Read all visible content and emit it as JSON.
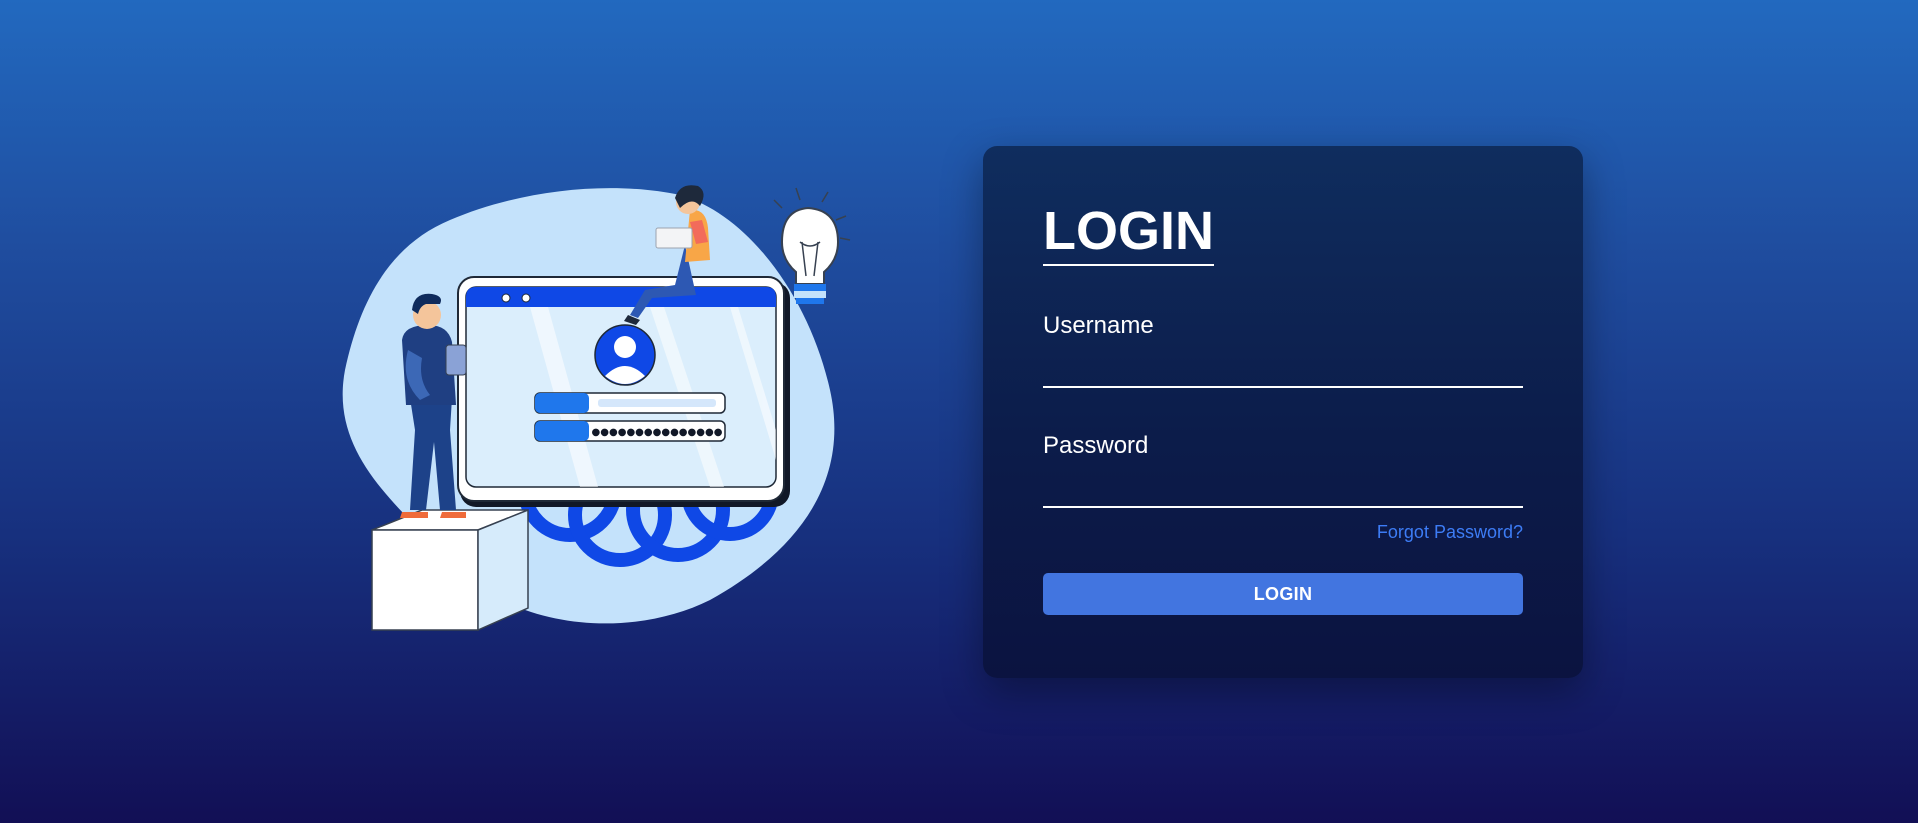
{
  "login_card": {
    "title": "LOGIN",
    "username_label": "Username",
    "username_value": "",
    "password_label": "Password",
    "password_value": "",
    "forgot_link": "Forgot Password?",
    "submit_label": "LOGIN"
  },
  "illustration": {
    "password_mask": "●●●●●●●●●●●●●●●",
    "icons": [
      "user-avatar-icon",
      "lightbulb-icon"
    ]
  },
  "colors": {
    "background_top": "#2269bf",
    "background_bottom": "#120f55",
    "card_background": "#0c1c4a",
    "button": "#4275e0",
    "link": "#3d7cf5",
    "illustration_accent": "#0f48e6",
    "illustration_blob": "#c4e2fb"
  }
}
